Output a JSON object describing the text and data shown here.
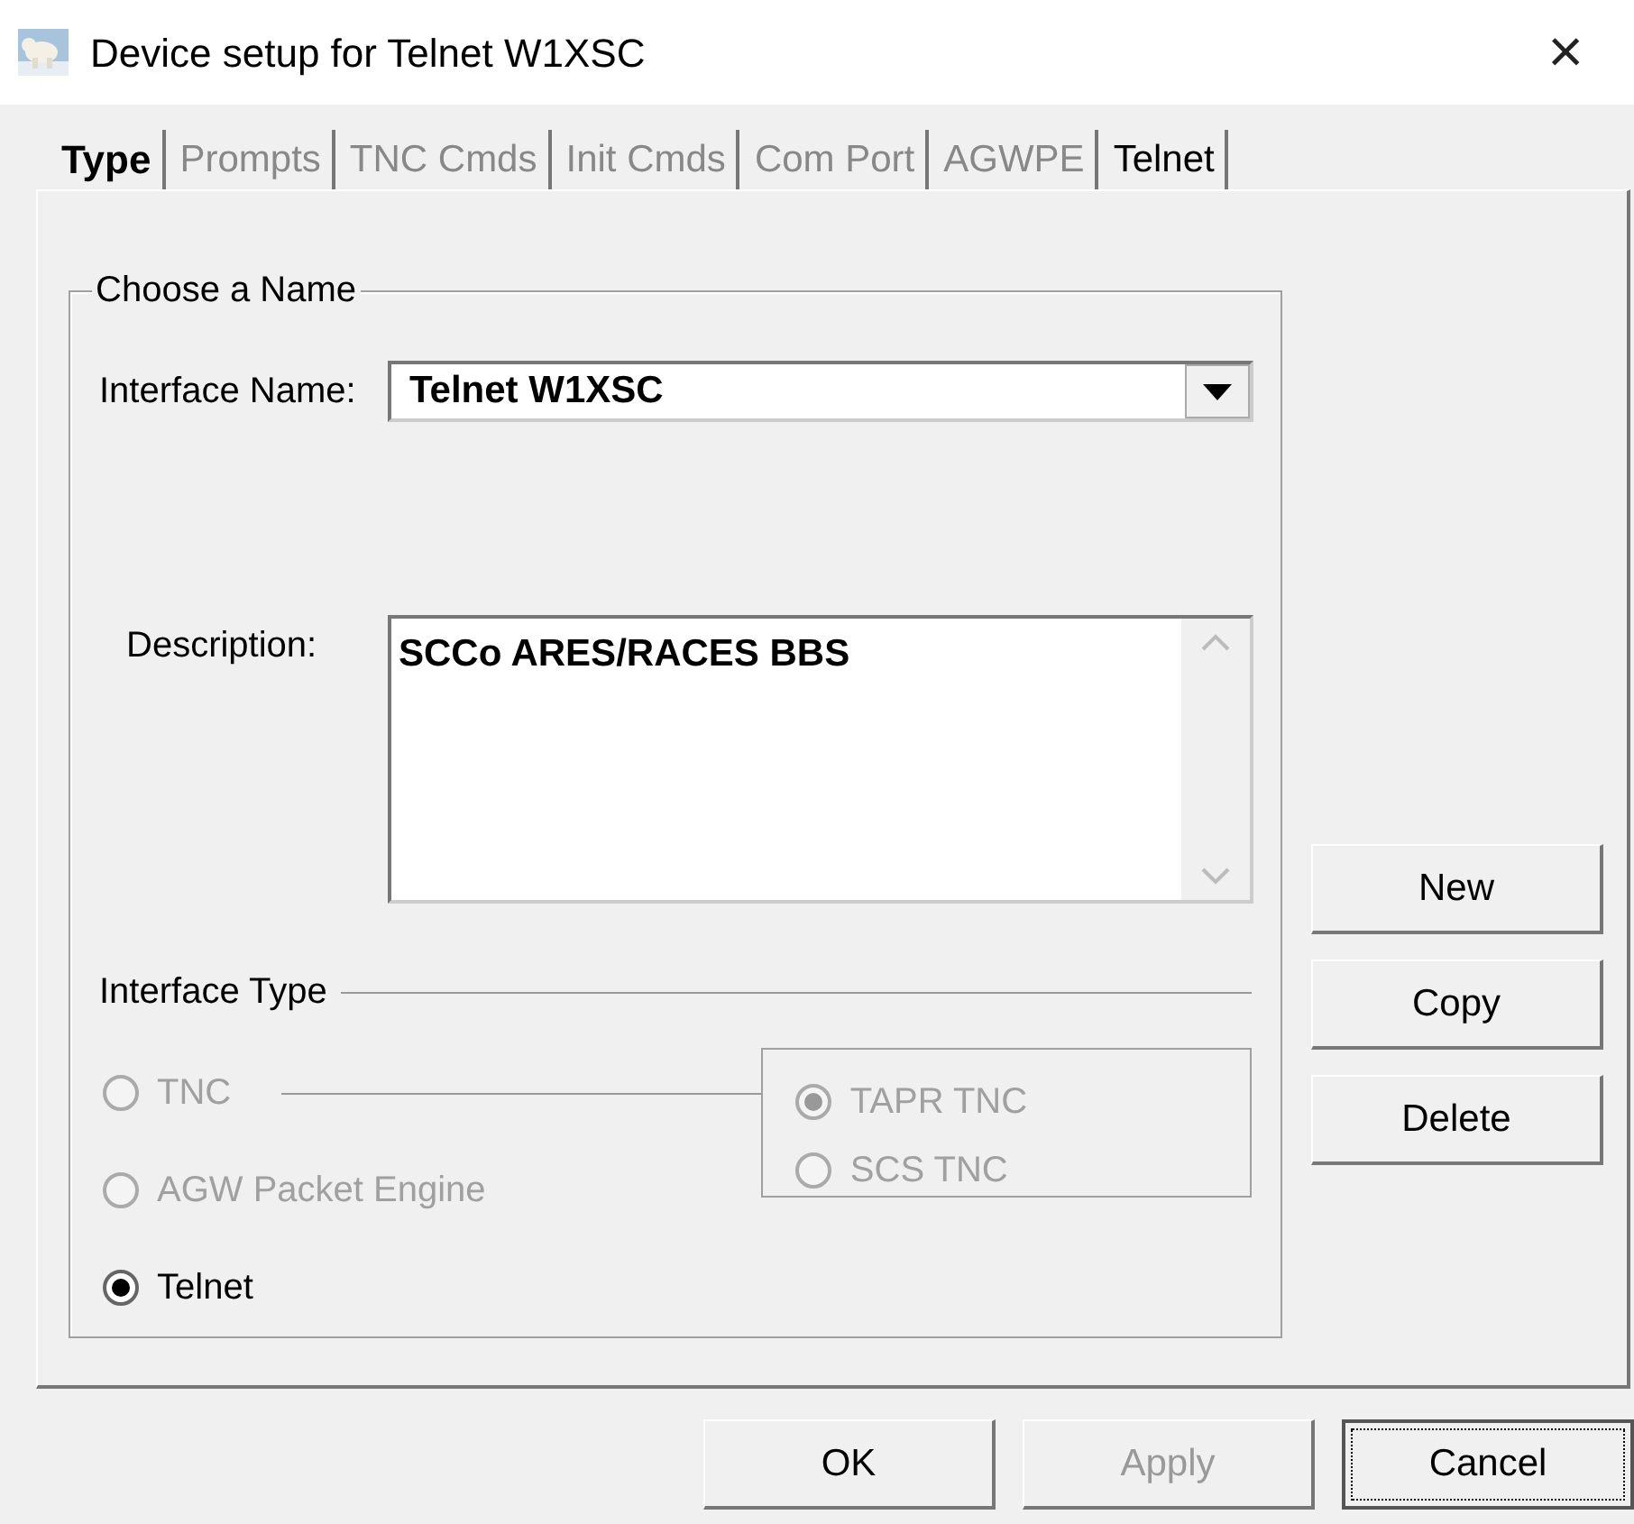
{
  "window": {
    "title": "Device setup for Telnet W1XSC",
    "close": "×"
  },
  "tabs": [
    {
      "label": "Type",
      "selected": true,
      "disabled": false
    },
    {
      "label": "Prompts",
      "selected": false,
      "disabled": true
    },
    {
      "label": "TNC Cmds",
      "selected": false,
      "disabled": true
    },
    {
      "label": "Init Cmds",
      "selected": false,
      "disabled": true
    },
    {
      "label": "Com Port",
      "selected": false,
      "disabled": true
    },
    {
      "label": "AGWPE",
      "selected": false,
      "disabled": true
    },
    {
      "label": "Telnet",
      "selected": false,
      "disabled": false
    }
  ],
  "name_group": {
    "title": "Choose a Name",
    "interface_name": {
      "label": "Interface Name:",
      "value": "Telnet W1XSC"
    },
    "description": {
      "label": "Description:",
      "value": "SCCo ARES/RACES BBS"
    },
    "interface_type": {
      "title": "Interface Type",
      "options": [
        {
          "label": "TNC",
          "selected": false,
          "disabled": true
        },
        {
          "label": "AGW Packet Engine",
          "selected": false,
          "disabled": true
        },
        {
          "label": "Telnet",
          "selected": true,
          "disabled": false
        }
      ],
      "tnc_options": [
        {
          "label": "TAPR TNC",
          "selected": true,
          "disabled": true
        },
        {
          "label": "SCS TNC",
          "selected": false,
          "disabled": true
        }
      ]
    }
  },
  "side_buttons": [
    {
      "label": "New"
    },
    {
      "label": "Copy"
    },
    {
      "label": "Delete"
    }
  ],
  "footer_buttons": [
    {
      "label": "OK",
      "disabled": false,
      "focused": false
    },
    {
      "label": "Apply",
      "disabled": true,
      "focused": false
    },
    {
      "label": "Cancel",
      "disabled": false,
      "focused": true
    }
  ]
}
